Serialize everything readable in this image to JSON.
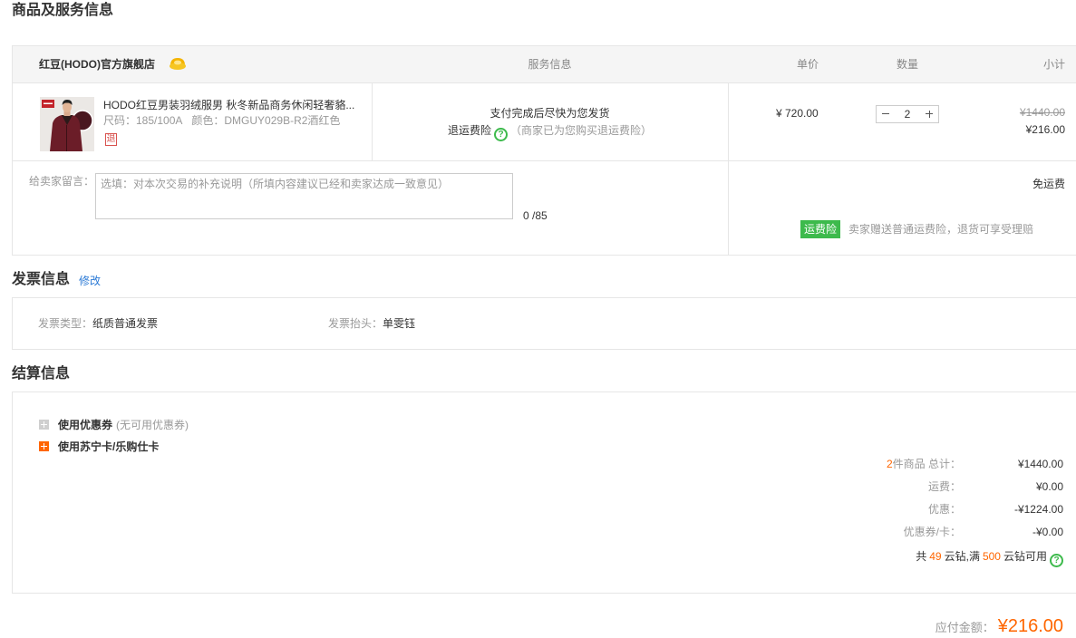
{
  "sections": {
    "goods_title": "商品及服务信息",
    "invoice_title": "发票信息",
    "invoice_edit": "修改",
    "settlement_title": "结算信息"
  },
  "order": {
    "header": {
      "store_name": "红豆(HODO)官方旗舰店",
      "store_icon": "store-level-icon",
      "service": "服务信息",
      "unit_price": "单价",
      "quantity": "数量",
      "subtotal": "小计"
    },
    "item": {
      "title": "HODO红豆男装羽绒服男 秋冬新品商务休闲轻奢貉...",
      "size": "尺码：185/100A",
      "color": "颜色：DMGUY029B-R2酒红色",
      "return_badge": "退",
      "delivery_note": "支付完成后尽快为您发货",
      "insurance_label": "退运费险",
      "insurance_note": "（商家已为您购买退运费险）",
      "unit_price": "¥ 720.00",
      "quantity": "2",
      "original_subtotal": "¥1440.00",
      "subtotal": "¥216.00"
    },
    "message": {
      "label": "给卖家留言：",
      "value": "",
      "placeholder": "选填：对本次交易的补充说明（所填内容建议已经和卖家达成一致意见）",
      "counter": "0 /85"
    },
    "shipping": {
      "fee": "免运费",
      "badge": "运费险",
      "note": "卖家赠送普通运费险，退货可享受理赔"
    }
  },
  "invoice": {
    "type_label": "发票类型：",
    "type_value": "纸质普通发票",
    "header_label": "发票抬头：",
    "header_value": "单雯钰"
  },
  "settlement": {
    "coupon": {
      "label": "使用优惠券",
      "note": "(无可用优惠券)",
      "icon": "expand-plus-icon"
    },
    "card": {
      "label": "使用苏宁卡/乐购仕卡",
      "icon": "expand-plus-icon"
    },
    "item_count": "2",
    "summary": [
      {
        "label": "件商品 总计：",
        "value": "¥1440.00"
      },
      {
        "label": "运费：",
        "value": "¥0.00"
      },
      {
        "label": "优惠：",
        "value": "-¥1224.00"
      },
      {
        "label": "优惠券/卡：",
        "value": "-¥0.00"
      }
    ],
    "yunzuan": {
      "prefix": "共",
      "count": "49",
      "middle": "云钻,满",
      "threshold": "500",
      "suffix": "云钻可用",
      "icon": "help-icon"
    }
  },
  "payable": {
    "label": "应付金额：",
    "amount": "¥216.00"
  },
  "colors": {
    "accent": "#ff6600",
    "success": "#3dba4c",
    "link": "#2b7ad6",
    "danger": "#d9534f",
    "muted": "#999999"
  }
}
